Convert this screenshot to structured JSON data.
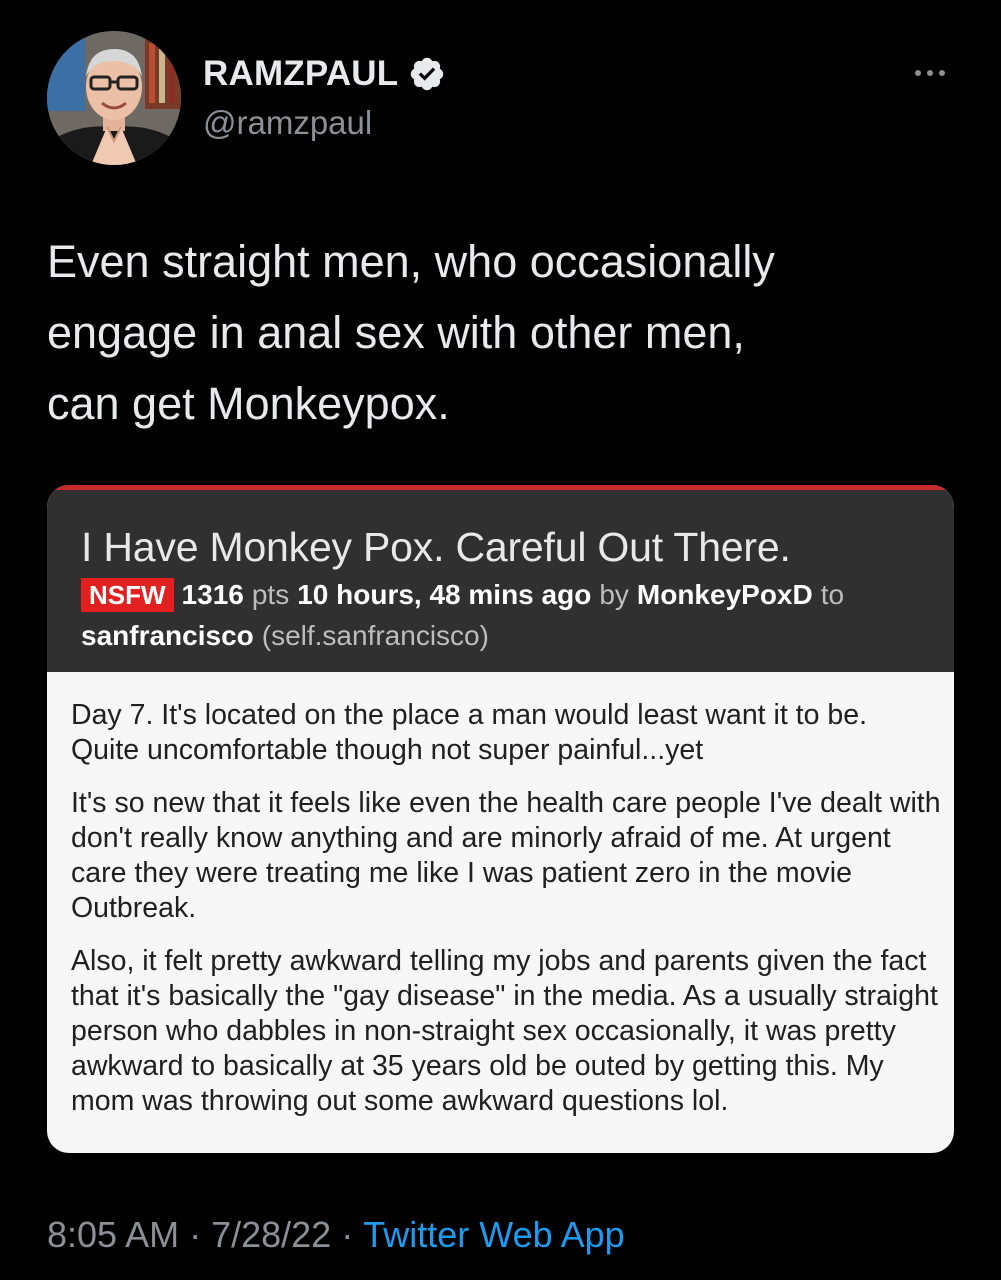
{
  "author": {
    "display_name": "RAMZPAUL",
    "handle": "@ramzpaul",
    "verified_icon": "verified-badge-icon",
    "more_icon": "more-options-icon"
  },
  "tweet": {
    "text_line1": "Even straight men, who occasionally",
    "text_line2": "engage in anal sex with other men,",
    "text_line3": "can get Monkeypox."
  },
  "embedded_post": {
    "title": "I Have Monkey Pox. Careful Out There.",
    "nsfw_label": "NSFW",
    "points": "1316",
    "points_unit": "pts",
    "age": "10 hours, 48 mins ago",
    "by_word": "by",
    "author": "MonkeyPoxD",
    "to_word": "to",
    "subreddit": "sanfrancisco",
    "domain": "(self.sanfrancisco)",
    "paragraphs": [
      "Day 7. It's located on the place a man would least want it to be. Quite uncomfortable though not super painful...yet",
      "It's so new that it feels like even the health care people I've dealt with don't really know anything and are minorly afraid of me. At urgent care they were treating me like I was patient zero in the movie Outbreak.",
      "Also, it felt pretty awkward telling my jobs and parents given the fact that it's basically the \"gay disease\" in the media. As a usually straight person who dabbles in non-straight sex occasionally, it was pretty awkward to basically at 35 years old be outed by getting this. My mom was throwing out some awkward questions lol."
    ],
    "colors": {
      "header_bg": "#303030",
      "accent_red": "#c92a2a",
      "body_bg": "#f7f7f7"
    }
  },
  "footer": {
    "time": "8:05 AM",
    "separator1": "·",
    "date": "7/28/22",
    "separator2": "·",
    "source": "Twitter Web App",
    "link_color": "#1d9bf0"
  }
}
